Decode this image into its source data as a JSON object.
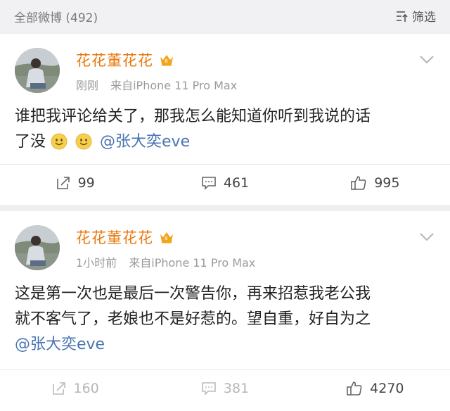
{
  "header": {
    "title": "全部微博 (492)",
    "filter_label": "筛选"
  },
  "posts": [
    {
      "author": "花花董花花",
      "time": "刚刚",
      "source": "来自iPhone 11 Pro Max",
      "text_line1": "谁把我评论给关了，那我怎么能知道你听到我说的话",
      "text_line2_prefix": "了没",
      "mention": "@张大奕eve",
      "reposts": "99",
      "comments": "461",
      "likes": "995"
    },
    {
      "author": "花花董花花",
      "time": "1小时前",
      "source": "来自iPhone 11 Pro Max",
      "text_line1": "这是第一次也是最后一次警告你，再来招惹我老公我",
      "text_line2": "就不客气了，老娘也不是好惹的。望自重，好自为之",
      "mention": "@张大奕eve",
      "reposts": "160",
      "comments": "381",
      "likes": "4270"
    }
  ],
  "colors": {
    "author": "#e8780e",
    "mention": "#4a74b0",
    "background": "#efeff1"
  }
}
